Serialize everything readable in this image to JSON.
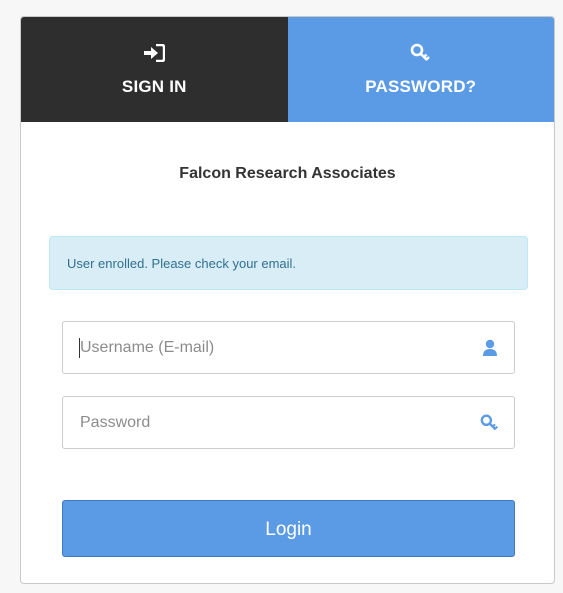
{
  "tabs": {
    "signin": {
      "label": "SIGN IN",
      "icon": "sign-in-icon",
      "color": "#2e2e2e"
    },
    "password": {
      "label": "PASSWORD?",
      "icon": "key-icon",
      "color": "#5b9be6"
    }
  },
  "organization": {
    "name": "Falcon Research Associates"
  },
  "alert": {
    "message": "User enrolled. Please check your email.",
    "color": "#d9edf7"
  },
  "form": {
    "username": {
      "placeholder": "Username (E-mail)",
      "value": "",
      "icon": "user-icon"
    },
    "password": {
      "placeholder": "Password",
      "value": "",
      "icon": "key-icon"
    },
    "login_label": "Login"
  },
  "colors": {
    "accent": "#5b9be6",
    "icon": "#5b9be6"
  }
}
